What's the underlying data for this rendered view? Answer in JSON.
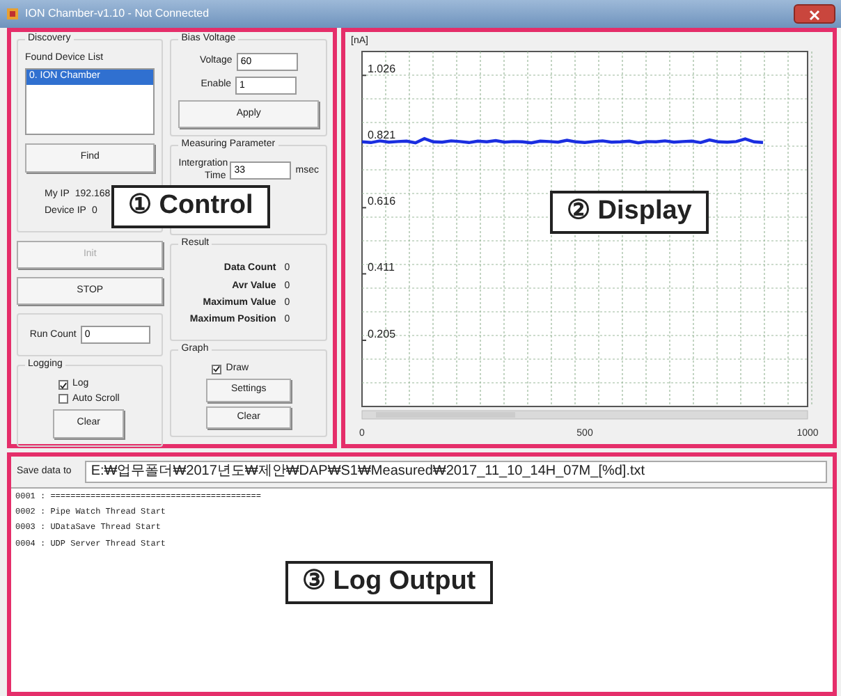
{
  "window": {
    "title": "ION Chamber-v1.10 - Not Connected"
  },
  "discovery": {
    "title": "Discovery",
    "list_label": "Found Device List",
    "devices": [
      {
        "label": "0. ION Chamber",
        "selected": true
      }
    ],
    "find_button": "Find",
    "info": [
      {
        "label": "My IP",
        "value": "192.168"
      },
      {
        "label": "Device IP",
        "value": "0"
      }
    ]
  },
  "init_button": {
    "label": "Init",
    "disabled": true
  },
  "stop_button": {
    "label": "STOP",
    "disabled": false
  },
  "run_count": {
    "label": "Run Count",
    "value": "0"
  },
  "logging": {
    "title": "Logging",
    "options": [
      {
        "label": "Log",
        "checked": true
      },
      {
        "label": "Auto Scroll",
        "checked": false
      }
    ],
    "clear_button": "Clear"
  },
  "bias_voltage": {
    "title": "Bias Voltage",
    "fields": [
      {
        "label": "Voltage",
        "value": "60"
      },
      {
        "label": "Enable",
        "value": "1"
      }
    ],
    "apply_button": "Apply"
  },
  "measuring_parameter": {
    "title": "Measuring Parameter",
    "field": {
      "label": "Intergration Time",
      "value": "33",
      "unit": "msec"
    }
  },
  "result": {
    "title": "Result",
    "rows": [
      {
        "label": "Data Count",
        "value": "0"
      },
      {
        "label": "Avr Value",
        "value": "0"
      },
      {
        "label": "Maximum Value",
        "value": "0"
      },
      {
        "label": "Maximum Position",
        "value": "0"
      }
    ]
  },
  "graph": {
    "title": "Graph",
    "draw": {
      "label": "Draw",
      "checked": true
    },
    "buttons": [
      "Settings",
      "Clear"
    ]
  },
  "display": {
    "unit": "[nA]",
    "chart_data": {
      "type": "line",
      "x": [
        0,
        20,
        40,
        60,
        80,
        100,
        120,
        140,
        160,
        180,
        200,
        220,
        240,
        260,
        280,
        300,
        320,
        340,
        360,
        380,
        400,
        420,
        440,
        460,
        480,
        500,
        520,
        540,
        560,
        580,
        600,
        620,
        640,
        660,
        680,
        700,
        720,
        740,
        760,
        780,
        800,
        820,
        840,
        860,
        880,
        900
      ],
      "series": [
        {
          "color": "#1a2ee0",
          "values": [
            0.82,
            0.818,
            0.823,
            0.819,
            0.821,
            0.822,
            0.817,
            0.83,
            0.82,
            0.819,
            0.823,
            0.821,
            0.818,
            0.822,
            0.82,
            0.824,
            0.819,
            0.821,
            0.82,
            0.817,
            0.822,
            0.821,
            0.819,
            0.825,
            0.82,
            0.818,
            0.821,
            0.823,
            0.819,
            0.82,
            0.822,
            0.817,
            0.821,
            0.82,
            0.823,
            0.819,
            0.821,
            0.822,
            0.818,
            0.826,
            0.82,
            0.819,
            0.821,
            0.829,
            0.82,
            0.818
          ]
        }
      ],
      "xlim": [
        0,
        1000
      ],
      "ylim": [
        0,
        1.1
      ],
      "xticks": [
        0,
        500,
        1000
      ],
      "yticks": [
        {
          "value": 1.026,
          "label": "1.026"
        },
        {
          "value": 0.821,
          "label": "0.821"
        },
        {
          "value": 0.616,
          "label": "0.616"
        },
        {
          "value": 0.411,
          "label": "0.411"
        },
        {
          "value": 0.205,
          "label": "0.205"
        }
      ]
    }
  },
  "log": {
    "save_label": "Save data to",
    "save_path": "E:₩업무폴더₩2017년도₩제안₩DAP₩S1₩Measured₩2017_11_10_14H_07M_[%d].txt",
    "lines": [
      "0001 : ==========================================",
      "0002 : Pipe Watch Thread Start",
      "0003 : UDataSave Thread Start",
      "0004 : UDP Server Thread Start"
    ]
  },
  "callouts": [
    {
      "label": "① Control"
    },
    {
      "label": "② Display"
    },
    {
      "label": "③ Log Output"
    }
  ]
}
